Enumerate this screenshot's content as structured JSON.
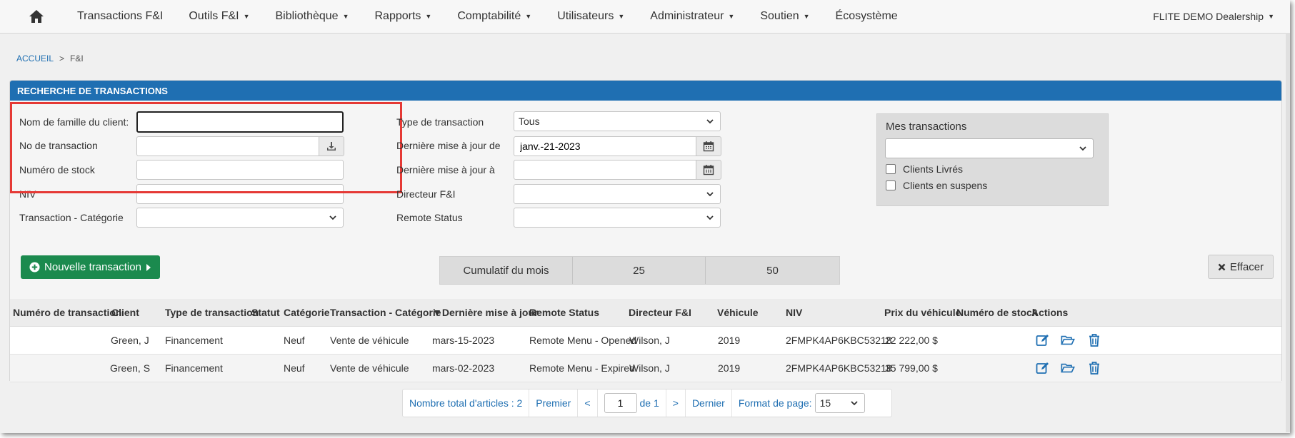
{
  "nav": {
    "items": [
      "Transactions F&I",
      "Outils F&I",
      "Bibliothèque",
      "Rapports",
      "Comptabilité",
      "Utilisateurs",
      "Administrateur",
      "Soutien",
      "Écosystème"
    ],
    "dealership": "FLITE DEMO Dealership"
  },
  "breadcrumb": {
    "home": "ACCUEIL",
    "sep": ">",
    "current": "F&I"
  },
  "panel": {
    "title": "RECHERCHE DE TRANSACTIONS"
  },
  "form": {
    "last_name_label": "Nom de famille du client:",
    "last_name_value": "",
    "transaction_no_label": "No de transaction",
    "transaction_no_value": "",
    "stock_no_label": "Numéro de stock",
    "stock_no_value": "",
    "vin_label": "NIV",
    "vin_value": "",
    "category_label": "Transaction - Catégorie",
    "category_value": "",
    "type_label": "Type de transaction",
    "type_value": "Tous",
    "updated_from_label": "Dernière mise à jour de",
    "updated_from_value": "janv.-21-2023",
    "updated_to_label": "Dernière mise à jour à",
    "updated_to_value": "",
    "director_label": "Directeur F&I",
    "director_value": "",
    "remote_status_label": "Remote Status",
    "remote_status_value": ""
  },
  "mes_transactions": {
    "title": "Mes transactions",
    "select_value": "",
    "delivered_label": "Clients Livrés",
    "delivered_checked": false,
    "pending_label": "Clients en suspens",
    "pending_checked": false
  },
  "buttons": {
    "new_transaction": "Nouvelle transaction",
    "clear": "Effacer"
  },
  "cumulative": {
    "label": "Cumulatif du mois",
    "value1": "25",
    "value2": "50"
  },
  "table": {
    "columns": [
      "Numéro de transaction",
      "Client",
      "Type de transaction",
      "Statut",
      "Catégorie",
      "Transaction - Catégorie",
      "▼Dernière mise à jour",
      "Remote Status",
      "Directeur F&I",
      "Véhicule",
      "NIV",
      "Prix du véhicule",
      "Numéro de stock",
      "Actions"
    ],
    "rows": [
      [
        "",
        "Green, J",
        "Financement",
        "",
        "Neuf",
        "Vente de véhicule",
        "mars-15-2023",
        "Remote Menu - Opened",
        "Wilson, J",
        "2019",
        "2FMPK4AP6KBC53218",
        "22 222,00 $",
        ""
      ],
      [
        "",
        "Green, S",
        "Financement",
        "",
        "Neuf",
        "Vente de véhicule",
        "mars-02-2023",
        "Remote Menu - Expired",
        "Wilson, J",
        "2019",
        "2FMPK4AP6KBC53218",
        "35 799,00 $",
        ""
      ]
    ]
  },
  "pager": {
    "total": "Nombre total d'articles : 2",
    "first": "Premier",
    "prev": "<",
    "page": "1",
    "of": "de 1",
    "next": ">",
    "last": "Dernier",
    "page_size_label": "Format de page:",
    "page_size": "15"
  },
  "colors": {
    "header_blue": "#1f6fb2",
    "green": "#1b8a4e",
    "highlight_red": "#e53935",
    "link_blue": "#1f6fb2"
  }
}
